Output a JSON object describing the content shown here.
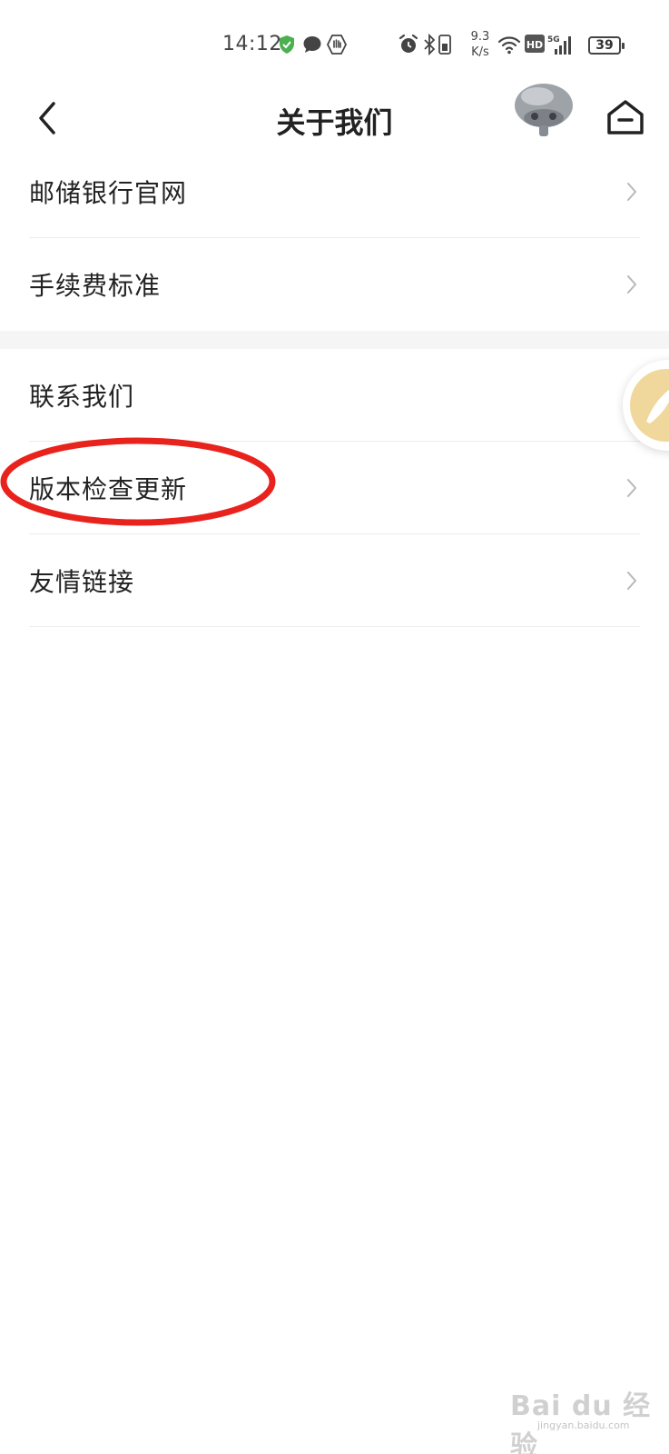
{
  "status_bar": {
    "time": "14:12",
    "net_speed_value": "9.3",
    "net_speed_unit": "K/s",
    "battery": "39",
    "icons": [
      "shield-check-icon",
      "chat-bubble-icon",
      "hand-icon",
      "alarm-icon",
      "bluetooth-icon",
      "phone-vibrate-icon",
      "wifi-icon",
      "hd-icon",
      "5g-signal-icon"
    ],
    "accent_color": "#4CAF50"
  },
  "header": {
    "title": "关于我们",
    "icons": [
      "back-arrow-icon",
      "avatar",
      "home-icon"
    ]
  },
  "list_groups": [
    {
      "items": [
        {
          "label": "邮储银行官网"
        },
        {
          "label": "手续费标准"
        }
      ]
    },
    {
      "items": [
        {
          "label": "联系我们"
        },
        {
          "label": "版本检查更新"
        },
        {
          "label": "友情链接"
        }
      ]
    }
  ],
  "annotation": {
    "color": "#E8231E",
    "target": "版本检查更新"
  },
  "watermark": {
    "main": "Bai du 经验",
    "sub": "jingyan.baidu.com"
  }
}
